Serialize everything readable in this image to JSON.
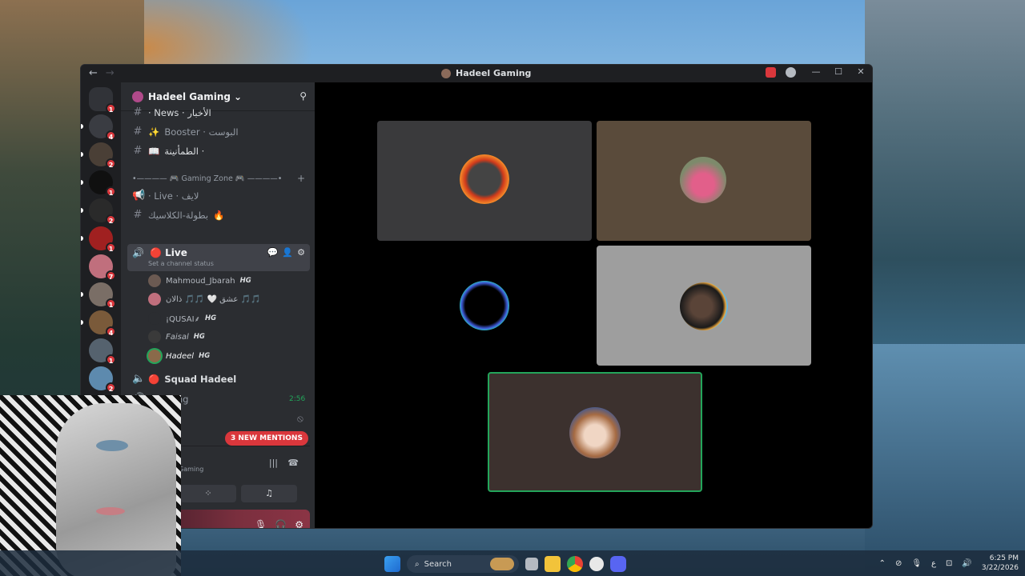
{
  "window": {
    "title": "Hadeel Gaming",
    "nav_back": "←",
    "nav_forward": "→",
    "controls": {
      "minimize": "—",
      "maximize": "☐",
      "close": "✕"
    }
  },
  "servers": [
    {
      "badge": "1",
      "color": "#5865f2"
    },
    {
      "badge": "4",
      "color": "#3a3c42"
    },
    {
      "badge": "2",
      "color": "#4a3f36"
    },
    {
      "badge": "1",
      "color": "#101010"
    },
    {
      "badge": "2",
      "color": "#2a2a2a"
    },
    {
      "badge": "1",
      "color": "#a02020"
    },
    {
      "badge": "7",
      "color": "#c06f7d"
    },
    {
      "badge": "1",
      "color": "#7a6e66"
    },
    {
      "badge": "4",
      "color": "#7a5a3a"
    },
    {
      "badge": "1",
      "color": "#55626e"
    },
    {
      "badge": "2",
      "color": "#5d8aae"
    }
  ],
  "server": {
    "name": "Hadeel Gaming",
    "chevron": "⌄",
    "add_member_icon": "⚲"
  },
  "channels": {
    "news": "·  News ·  الأخبار",
    "booster": "Booster · البوست",
    "tamaninah": "الطمأنينة ·",
    "category": "Gaming Zone",
    "live_text": "· Live · لايف",
    "classic": "بطولة-الكلاسيك",
    "live_active": "Live",
    "status_hint": "Set a channel status",
    "squad": "Squad Hadeel",
    "waiting": "· Waiting",
    "waiting_time": "2:56"
  },
  "voice_users": [
    {
      "name": "Mahmoud_Jbarah",
      "tag": "HG"
    },
    {
      "name": "عشق 🤍 🎵🎵 ذالان 🎵🎵",
      "tag": ""
    },
    {
      "name": "¡QUSAI⸙",
      "tag": "HG"
    },
    {
      "name": "Faisal",
      "tag": "HG"
    },
    {
      "name": "Hadeel",
      "tag": "HG"
    }
  ],
  "mentions": "3 NEW MENTIONS",
  "voice_panel": {
    "server_sub": "Gaming"
  },
  "taskbar": {
    "search": "Search",
    "time": "6:25 PM",
    "date": "3/22/2026",
    "lang": "ع"
  }
}
